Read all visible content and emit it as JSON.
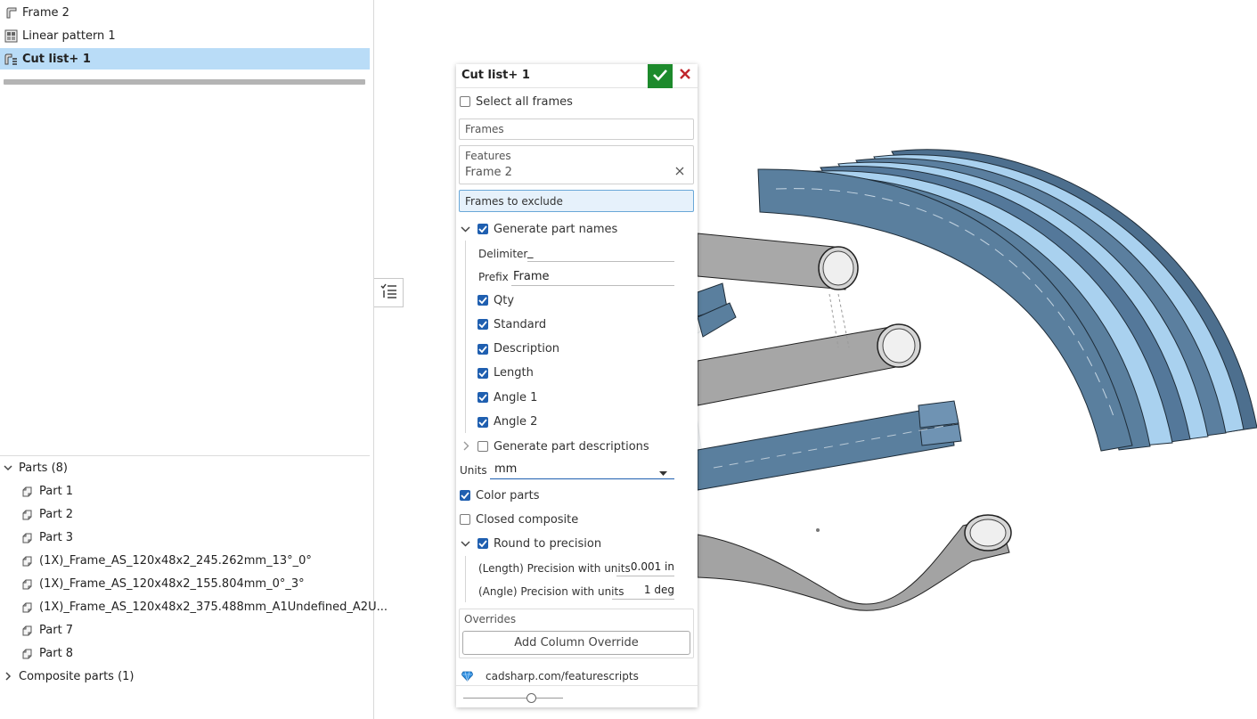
{
  "feature_tree": {
    "items": [
      {
        "label": "Frame 2",
        "icon": "frame-icon",
        "selected": false
      },
      {
        "label": "Linear pattern 1",
        "icon": "linear-pattern-icon",
        "selected": false
      },
      {
        "label": "Cut list+ 1",
        "icon": "cutlist-icon",
        "selected": true
      }
    ]
  },
  "parts_section": {
    "header": "Parts (8)",
    "parts": [
      "Part 1",
      "Part 2",
      "Part 3",
      "(1X)_Frame_AS_120x48x2_245.262mm_13°_0°",
      "(1X)_Frame_AS_120x48x2_155.804mm_0°_3°",
      "(1X)_Frame_AS_120x48x2_375.488mm_A1Undefined_A2U...",
      "Part 7",
      "Part 8"
    ],
    "composite_header": "Composite parts (1)"
  },
  "dialog": {
    "title": "Cut list+ 1",
    "select_all_frames": "Select all frames",
    "frames_placeholder": "Frames",
    "features_label": "Features",
    "features_value": "Frame 2",
    "frames_to_exclude": "Frames to exclude",
    "generate_part_names": "Generate part names",
    "delimiter_label": "Delimiter",
    "delimiter_value": "_",
    "prefix_label": "Prefix",
    "prefix_value": "Frame",
    "name_options": [
      "Qty",
      "Standard",
      "Description",
      "Length",
      "Angle 1",
      "Angle 2"
    ],
    "generate_part_descriptions": "Generate part descriptions",
    "units_label": "Units",
    "units_value": "mm",
    "color_parts": "Color parts",
    "closed_composite": "Closed composite",
    "round_to_precision": "Round to precision",
    "length_precision_label": "(Length) Precision with units",
    "length_precision_value": "0.001 in",
    "angle_precision_label": "(Angle) Precision with units",
    "angle_precision_value": "1 deg",
    "overrides_label": "Overrides",
    "add_column_override": "Add Column Override",
    "footer_link": "cadsharp.com/featurescripts",
    "slider_value": 0.68
  },
  "colors": {
    "selection": "#b9dcf7",
    "accept_green": "#1d8a2c",
    "cancel_red": "#c0262d",
    "checkbox_blue": "#1f5fb0",
    "frame_blue": "#5a7f9e",
    "tube_gray": "#9a9a9a"
  }
}
